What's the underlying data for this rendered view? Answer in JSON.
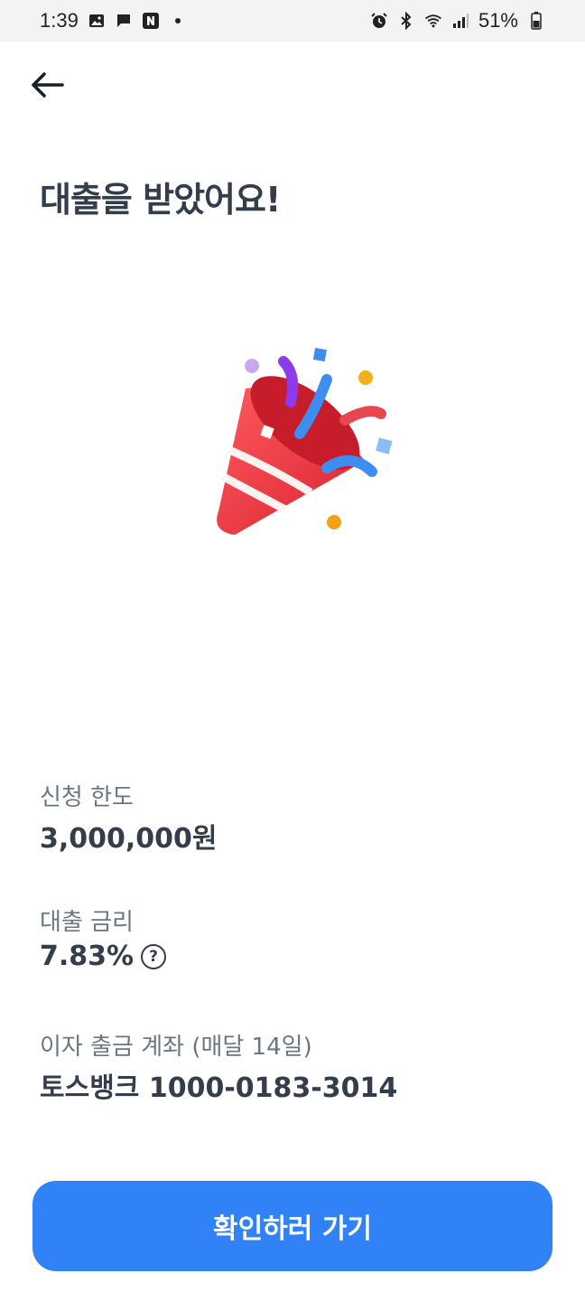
{
  "status_bar": {
    "time": "1:39",
    "battery_pct": "51%",
    "left_icons": [
      "gallery-icon",
      "message-icon",
      "naver-icon",
      "dot-icon"
    ],
    "right_icons": [
      "alarm-icon",
      "bluetooth-icon",
      "wifi-icon",
      "signal-icon",
      "battery-icon"
    ]
  },
  "header": {
    "title": "대출을 받았어요!"
  },
  "illustration": {
    "icon": "party-popper-icon"
  },
  "info": {
    "limit": {
      "label": "신청 한도",
      "value": "3,000,000원"
    },
    "rate": {
      "label": "대출 금리",
      "value": "7.83%"
    },
    "account": {
      "label": "이자 출금 계좌 (매달 14일)",
      "value": "토스뱅크 1000-0183-3014"
    }
  },
  "cta": {
    "label": "확인하러 가기"
  },
  "colors": {
    "accent": "#3182f6",
    "text": "#333d4b",
    "sub_text": "#6b7684"
  }
}
